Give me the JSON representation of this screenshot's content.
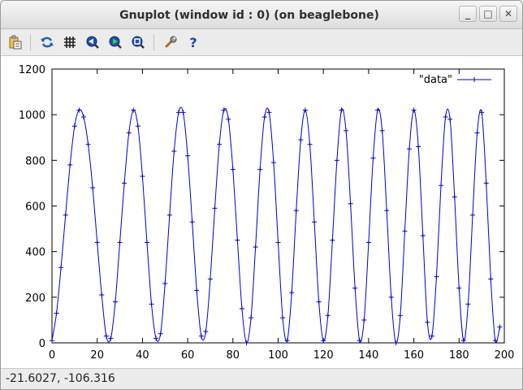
{
  "window": {
    "title": "Gnuplot (window id : 0) (on beaglebone)",
    "controls": {
      "minimize": "_",
      "maximize": "□",
      "close": "✕"
    }
  },
  "toolbar": {
    "items": [
      {
        "icon": "copy-to-clipboard-icon"
      },
      {
        "icon": "replot-icon"
      },
      {
        "icon": "grid-icon"
      },
      {
        "icon": "previous-zoom-icon"
      },
      {
        "icon": "next-zoom-icon"
      },
      {
        "icon": "autoscale-icon"
      },
      {
        "icon": "preferences-wrench-icon"
      },
      {
        "icon": "help-icon"
      }
    ]
  },
  "status": {
    "coords": "-21.6027, -106.316"
  },
  "colors": {
    "series": "#0000cc",
    "axis": "#000000"
  },
  "chart_data": {
    "type": "line",
    "title": "",
    "xlabel": "",
    "ylabel": "",
    "xlim": [
      0,
      200
    ],
    "ylim": [
      0,
      1200
    ],
    "xticks": [
      0,
      20,
      40,
      60,
      80,
      100,
      120,
      140,
      160,
      180,
      200
    ],
    "yticks": [
      0,
      200,
      400,
      600,
      800,
      1000,
      1200
    ],
    "grid": false,
    "legend": "top-right",
    "point_marker": "plus",
    "series": [
      {
        "name": "\"data\"",
        "color": "#0000cc",
        "x": [
          0,
          2,
          4,
          6,
          8,
          10,
          12,
          14,
          16,
          18,
          20,
          22,
          24,
          26,
          28,
          30,
          32,
          34,
          36,
          38,
          40,
          42,
          44,
          46,
          48,
          50,
          52,
          54,
          56,
          58,
          60,
          62,
          64,
          66,
          68,
          70,
          72,
          74,
          76,
          78,
          80,
          82,
          84,
          86,
          88,
          90,
          92,
          94,
          96,
          98,
          100,
          102,
          104,
          106,
          108,
          110,
          112,
          114,
          116,
          118,
          120,
          122,
          124,
          126,
          128,
          130,
          132,
          134,
          136,
          138,
          140,
          142,
          144,
          146,
          148,
          150,
          152,
          154,
          156,
          158,
          160,
          162,
          164,
          166,
          168,
          170,
          172,
          174,
          176,
          178,
          180,
          182,
          184,
          186,
          188,
          190,
          192,
          194,
          196,
          198
        ],
        "values": [
          10,
          130,
          330,
          560,
          780,
          950,
          1020,
          990,
          870,
          680,
          440,
          210,
          30,
          20,
          180,
          440,
          700,
          920,
          1020,
          950,
          730,
          440,
          170,
          20,
          40,
          260,
          560,
          840,
          1010,
          1010,
          820,
          530,
          230,
          30,
          50,
          280,
          590,
          870,
          1020,
          980,
          760,
          450,
          150,
          0,
          110,
          420,
          760,
          990,
          1010,
          790,
          440,
          110,
          10,
          220,
          580,
          890,
          1020,
          870,
          530,
          180,
          10,
          120,
          450,
          800,
          1020,
          930,
          610,
          240,
          10,
          100,
          440,
          810,
          1020,
          930,
          580,
          200,
          0,
          120,
          490,
          850,
          1020,
          860,
          470,
          90,
          30,
          290,
          690,
          990,
          980,
          640,
          240,
          10,
          170,
          560,
          920,
          1010,
          700,
          280,
          10,
          70
        ]
      }
    ]
  }
}
